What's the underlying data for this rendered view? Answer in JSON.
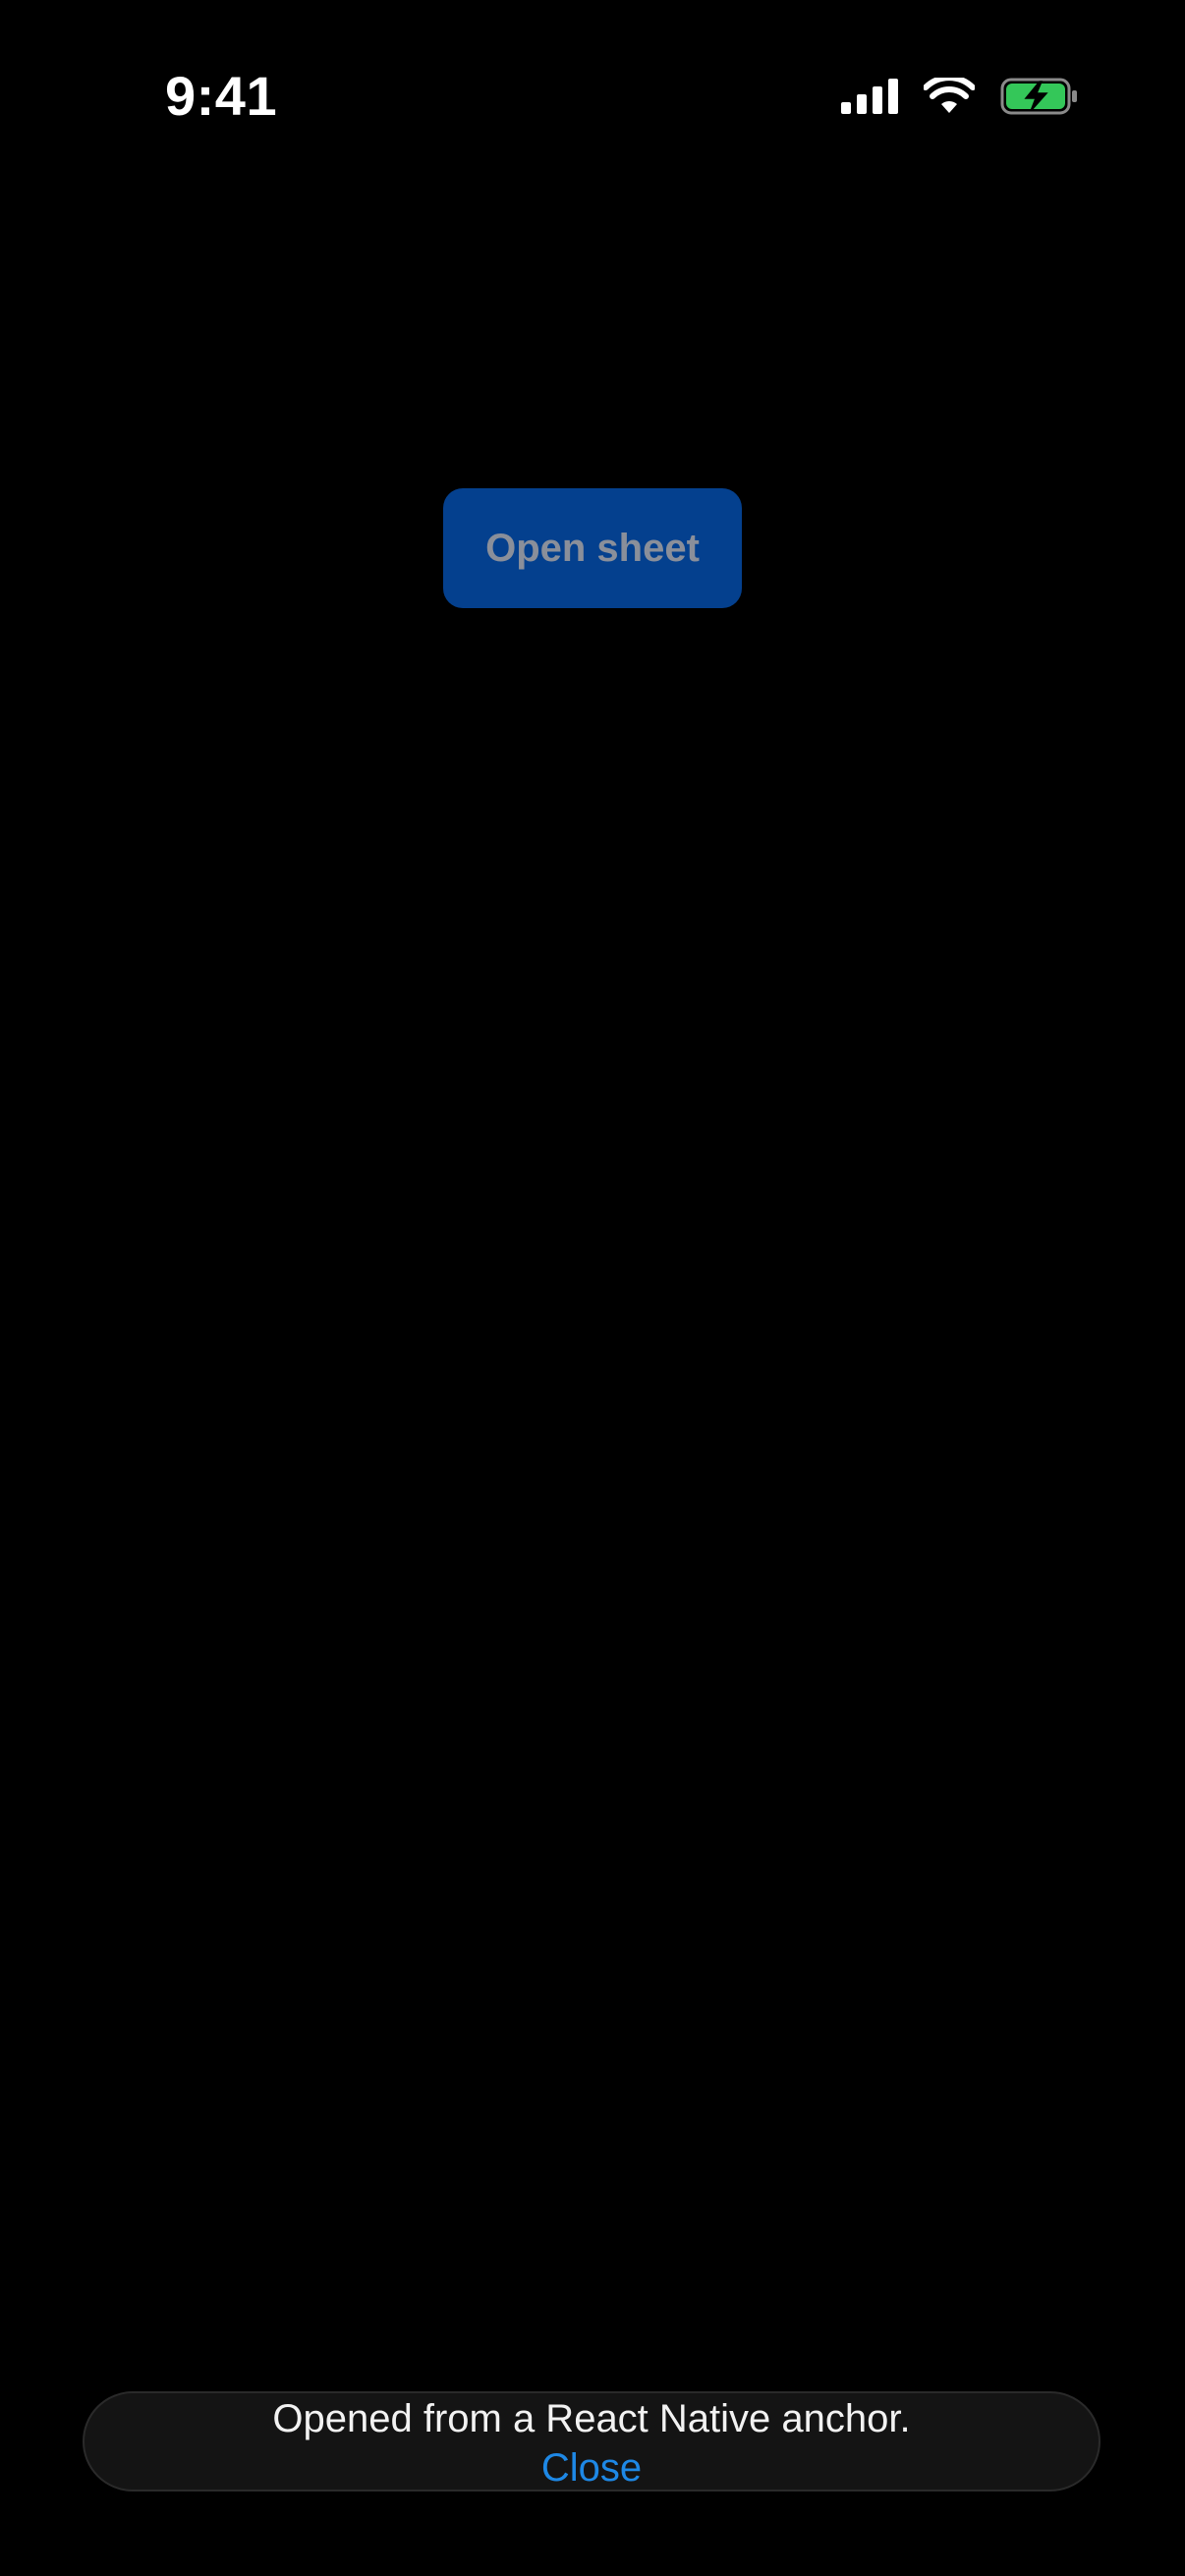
{
  "status_bar": {
    "time": "9:41",
    "icons": [
      "cellular-signal-icon",
      "wifi-icon",
      "battery-charging-icon"
    ],
    "battery_color": "#34c759"
  },
  "main": {
    "open_sheet_label": "Open sheet",
    "button_color": "#04408e"
  },
  "sheet": {
    "message": "Opened from a React Native anchor.",
    "close_label": "Close",
    "close_color": "#1e88e5"
  }
}
